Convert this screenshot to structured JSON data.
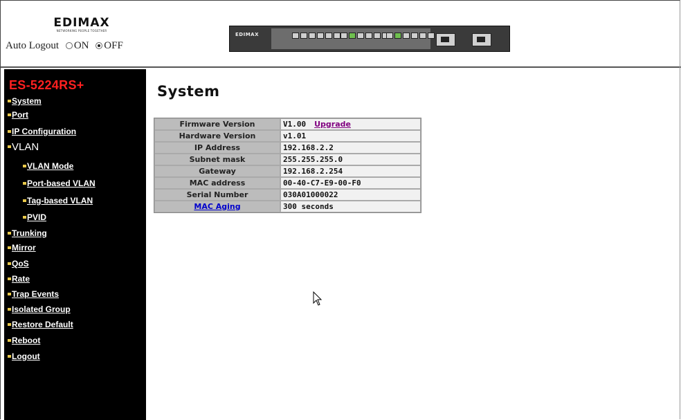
{
  "header": {
    "logo_text": "EDIMAX",
    "logo_tagline": "NETWORKING PEOPLE TOGETHER",
    "auto_logout_label": "Auto Logout",
    "on_label": "ON",
    "off_label": "OFF",
    "auto_logout_selected": "OFF",
    "switch_brand": "EDIMAX"
  },
  "sidebar": {
    "model": "ES-5224RS+",
    "items": [
      {
        "label": "System"
      },
      {
        "label": "Port"
      },
      {
        "label": "IP Configuration"
      },
      {
        "label": "VLAN"
      },
      {
        "label": "VLAN Mode"
      },
      {
        "label": "Port-based VLAN"
      },
      {
        "label": "Tag-based VLAN"
      },
      {
        "label": "PVID"
      },
      {
        "label": "Trunking"
      },
      {
        "label": "Mirror"
      },
      {
        "label": "QoS"
      },
      {
        "label": "Rate"
      },
      {
        "label": "Trap Events"
      },
      {
        "label": "Isolated Group"
      },
      {
        "label": "Restore Default"
      },
      {
        "label": "Reboot"
      },
      {
        "label": "Logout"
      }
    ]
  },
  "main": {
    "title": "System",
    "rows": [
      {
        "key": "Firmware Version",
        "value": "V1.00",
        "link": "Upgrade"
      },
      {
        "key": "Hardware Version",
        "value": "v1.01"
      },
      {
        "key": "IP Address",
        "value": "192.168.2.2"
      },
      {
        "key": "Subnet mask",
        "value": "255.255.255.0"
      },
      {
        "key": "Gateway",
        "value": "192.168.2.254"
      },
      {
        "key": "MAC address",
        "value": "00-40-C7-E9-00-F0"
      },
      {
        "key": "Serial Number",
        "value": "030A01000022"
      },
      {
        "key": "MAC Aging",
        "value": "300 seconds"
      }
    ]
  },
  "colors": {
    "sidebar_bg": "#000000",
    "model_text": "#ff2020",
    "bullet": "#e8c84a",
    "table_key_bg": "#bcbcbc",
    "table_value_bg": "#f1f1f1"
  },
  "icons": {
    "cursor": "mouse-pointer-icon",
    "bullet": "bullet-icon"
  }
}
